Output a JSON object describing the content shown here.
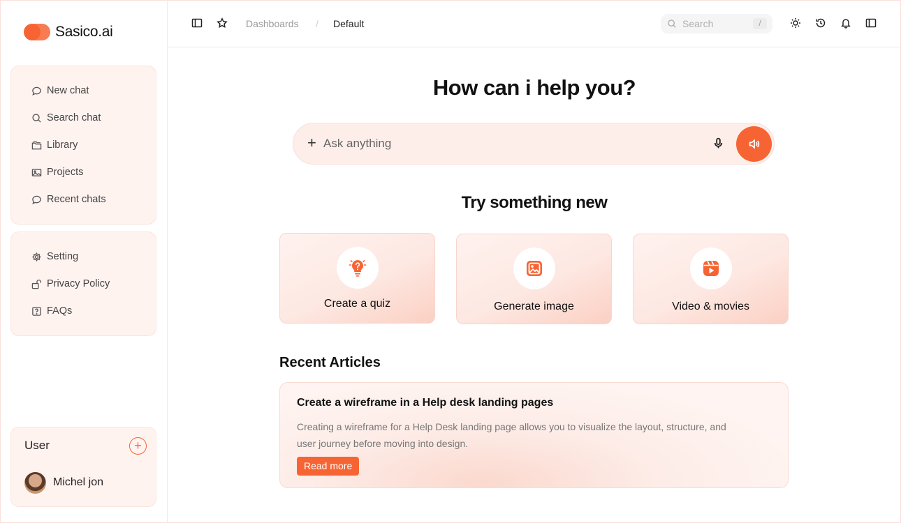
{
  "brand": {
    "name": "Sasico.ai"
  },
  "sidebar": {
    "primary": [
      {
        "label": "New chat",
        "icon": "chat-bubble-icon"
      },
      {
        "label": "Search chat",
        "icon": "search-icon"
      },
      {
        "label": "Library",
        "icon": "folder-icon"
      },
      {
        "label": "Projects",
        "icon": "image-icon"
      },
      {
        "label": "Recent chats",
        "icon": "chat-bubble-icon"
      }
    ],
    "secondary": [
      {
        "label": "Setting",
        "icon": "gear-icon"
      },
      {
        "label": "Privacy Policy",
        "icon": "lock-icon"
      },
      {
        "label": "FAQs",
        "icon": "help-icon"
      }
    ],
    "user": {
      "title": "User",
      "add_label": "+",
      "name": "Michel jon"
    }
  },
  "topbar": {
    "breadcrumb": [
      "Dashboards",
      "Default"
    ],
    "separator": "/",
    "search": {
      "placeholder": "Search",
      "shortcut": "/"
    }
  },
  "main": {
    "title": "How can i help you?",
    "ask": {
      "plus": "+",
      "placeholder": "Ask anything"
    },
    "try_title": "Try something new",
    "cards": [
      {
        "label": "Create a quiz",
        "icon": "lightbulb-question-icon"
      },
      {
        "label": "Generate image",
        "icon": "image-icon"
      },
      {
        "label": "Video & movies",
        "icon": "video-play-icon"
      }
    ],
    "articles_title": "Recent Articles",
    "article": {
      "title": "Create a wireframe in a Help desk landing pages",
      "description": "Creating a wireframe for a Help Desk landing page allows you to visualize the layout, structure, and user journey before moving into design.",
      "cta": "Read more"
    }
  },
  "colors": {
    "accent": "#f76433",
    "panel": "#fff3f0"
  }
}
